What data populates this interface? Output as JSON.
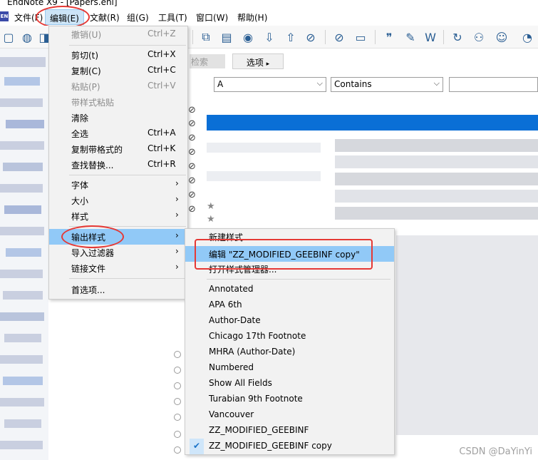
{
  "window": {
    "title": "EndNote X9 - [Papers.enl]"
  },
  "menubar": {
    "items": [
      {
        "label": "文件(F)"
      },
      {
        "label": "编辑(E)"
      },
      {
        "label": "文献(R)"
      },
      {
        "label": "组(G)"
      },
      {
        "label": "工具(T)"
      },
      {
        "label": "窗口(W)"
      },
      {
        "label": "帮助(H)"
      }
    ]
  },
  "app_icon": "EN",
  "search": {
    "search_label": "检索",
    "options_label": "选项",
    "field_value": "A",
    "operator_value": "Contains"
  },
  "edit_menu": {
    "items": [
      {
        "label": "撤销(U)",
        "shortcut": "Ctrl+Z"
      },
      {
        "label": "剪切(t)",
        "shortcut": "Ctrl+X"
      },
      {
        "label": "复制(C)",
        "shortcut": "Ctrl+C"
      },
      {
        "label": "粘贴(P)",
        "shortcut": "Ctrl+V"
      },
      {
        "label": "带样式粘贴",
        "shortcut": ""
      },
      {
        "label": "清除",
        "shortcut": ""
      },
      {
        "label": "全选",
        "shortcut": "Ctrl+A"
      },
      {
        "label": "复制带格式的",
        "shortcut": "Ctrl+K"
      },
      {
        "label": "查找替换...",
        "shortcut": "Ctrl+R"
      },
      {
        "label": "字体",
        "shortcut": ""
      },
      {
        "label": "大小",
        "shortcut": ""
      },
      {
        "label": "样式",
        "shortcut": ""
      },
      {
        "label": "输出样式",
        "shortcut": ""
      },
      {
        "label": "导入过滤器",
        "shortcut": ""
      },
      {
        "label": "链接文件",
        "shortcut": ""
      },
      {
        "label": "首选项...",
        "shortcut": ""
      }
    ]
  },
  "style_submenu": {
    "items": [
      {
        "label": "新建样式..."
      },
      {
        "label": "编辑 \"ZZ_MODIFIED_GEEBINF copy\""
      },
      {
        "label": "打开样式管理器..."
      },
      {
        "label": "Annotated"
      },
      {
        "label": "APA 6th"
      },
      {
        "label": "Author-Date"
      },
      {
        "label": "Chicago 17th Footnote"
      },
      {
        "label": "MHRA (Author-Date)"
      },
      {
        "label": "Numbered"
      },
      {
        "label": "Show All Fields"
      },
      {
        "label": "Turabian 9th Footnote"
      },
      {
        "label": "Vancouver"
      },
      {
        "label": "ZZ_MODIFIED_GEEBINF"
      },
      {
        "label": "ZZ_MODIFIED_GEEBINF copy"
      }
    ],
    "checked_index": 13
  },
  "watermark": "CSDN @DaYinYi",
  "colors": {
    "highlight": "#91c9f7",
    "annotation": "#e53935",
    "selection": "#0a6fd6"
  },
  "icons": [
    "clip-icon",
    "star-icon",
    "chevron-right-icon",
    "check-icon",
    "dropdown-arrow-icon"
  ]
}
